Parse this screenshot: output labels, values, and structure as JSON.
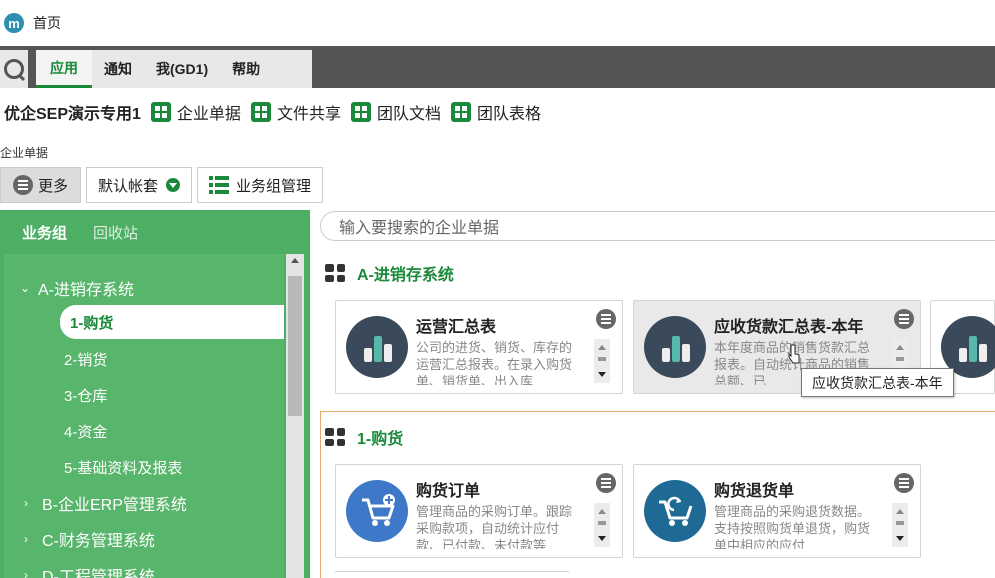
{
  "window": {
    "title": "首页",
    "logo_letter": "m"
  },
  "nav": {
    "tabs": [
      "应用",
      "通知",
      "我(GD1)",
      "帮助"
    ],
    "active": "应用"
  },
  "workspace": {
    "name": "优企SEP演示专用1",
    "links": [
      "企业单据",
      "文件共享",
      "团队文档",
      "团队表格"
    ]
  },
  "section_label": "企业单据",
  "toolbar": {
    "more": "更多",
    "account": "默认帐套",
    "business_group": "业务组管理"
  },
  "sidebar": {
    "tabs": [
      "业务组",
      "回收站"
    ],
    "tree": [
      {
        "label": "A-进销存系统",
        "expanded": true
      },
      {
        "label": "1-购货",
        "selected": true
      },
      {
        "label": "2-销货"
      },
      {
        "label": "3-仓库"
      },
      {
        "label": "4-资金"
      },
      {
        "label": "5-基础资料及报表"
      },
      {
        "label": "B-企业ERP管理系统",
        "expanded": false
      },
      {
        "label": "C-财务管理系统",
        "expanded": false
      },
      {
        "label": "D-工程管理系统",
        "expanded": false
      }
    ]
  },
  "search": {
    "placeholder": "输入要搜索的企业单据"
  },
  "categories": [
    {
      "title": "A-进销存系统",
      "cards": [
        {
          "title": "运营汇总表",
          "desc": "公司的进货、销货、库存的运营汇总报表。在录入购货单、销货单、出入库",
          "icon": "bar-chart-icon"
        },
        {
          "title": "应收货款汇总表-本年",
          "desc": "本年度商品的销售货款汇总报表。自动统计商品的销售总额、已",
          "icon": "bar-chart-icon"
        }
      ]
    },
    {
      "title": "1-购货",
      "cards": [
        {
          "title": "购货订单",
          "desc": "管理商品的采购订单。跟踪采购款项，自动统计应付款、已付款、未付款等",
          "icon": "cart-add-icon"
        },
        {
          "title": "购货退货单",
          "desc": "管理商品的采购退货数据。支持按照购货单退货，购货单中相应的应付",
          "icon": "cart-return-icon"
        }
      ]
    }
  ],
  "tooltip": "应收货款汇总表-本年",
  "colors": {
    "accent": "#1a8a3a",
    "sidebar": "#4caf63",
    "nav_dark": "#555555"
  }
}
